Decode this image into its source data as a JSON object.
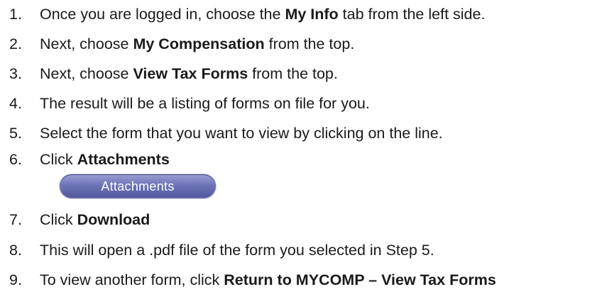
{
  "steps": [
    {
      "num": "1.",
      "text_before": "Once you are logged in, choose the ",
      "bold": "My Info",
      "text_after": " tab from the left side."
    },
    {
      "num": "2.",
      "text_before": "Next, choose ",
      "bold": "My Compensation",
      "text_after": " from the top."
    },
    {
      "num": "3.",
      "text_before": "Next, choose ",
      "bold": "View Tax Forms",
      "text_after": " from the top."
    },
    {
      "num": "4.",
      "text_before": "The result will be a listing of forms on file for you.",
      "bold": "",
      "text_after": ""
    },
    {
      "num": "5.",
      "text_before": "Select the form that you want to view by clicking on the line.",
      "bold": "",
      "text_after": ""
    },
    {
      "num": "6.",
      "text_before": "Click ",
      "bold": "Attachments",
      "text_after": ""
    },
    {
      "num": "7.",
      "text_before": "Click ",
      "bold": "Download",
      "text_after": ""
    },
    {
      "num": "8.",
      "text_before": "This will open a .pdf file of the form you selected in Step 5.",
      "bold": "",
      "text_after": ""
    },
    {
      "num": "9.",
      "text_before": "To view another form, click ",
      "bold": "Return to MYCOMP – View Tax Forms",
      "text_after": ""
    }
  ],
  "attachments_button": {
    "label": "Attachments",
    "color": "#6e74b8"
  }
}
